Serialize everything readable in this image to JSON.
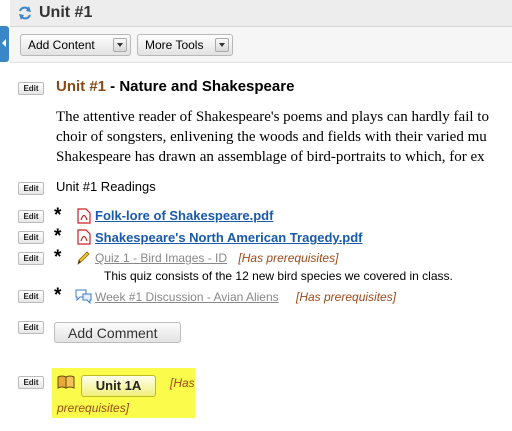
{
  "header": {
    "title": "Unit #1"
  },
  "toolbar": {
    "add_content": "Add Content",
    "more_tools": "More Tools"
  },
  "edit_label": "Edit",
  "heading": {
    "unit": "Unit #1",
    "rest": " - Nature and Shakespeare"
  },
  "body_lines": [
    "The attentive reader of Shakespeare's poems and plays can hardly fail to",
    "choir of songsters, enlivening the woods and fields with their varied mu",
    "Shakespeare has drawn an assemblage of bird-portraits to which, for ex"
  ],
  "readings_label": "Unit #1 Readings",
  "items": {
    "pdf1": "Folk-lore of Shakespeare.pdf",
    "pdf2": "Shakespeare's North American Tragedy.pdf",
    "quiz": "Quiz 1 - Bird Images - ID",
    "quiz_prereq": "[Has prerequisites]",
    "quiz_desc": "This quiz consists of the 12 new bird species we covered in class.",
    "discussion": "Week #1 Discussion - Avian Aliens",
    "discussion_prereq": "[Has prerequisites]"
  },
  "add_comment": "Add Comment",
  "unit_block": {
    "button": "Unit 1A",
    "prereq_line1": "[Has",
    "prereq_line2": "prerequisites]"
  },
  "colors": {
    "accent": "#3a87c8",
    "heading_unit": "#8a4a16",
    "link": "#1a5aab",
    "prereq": "#9b4a1a",
    "highlight": "#fbfb4b"
  }
}
